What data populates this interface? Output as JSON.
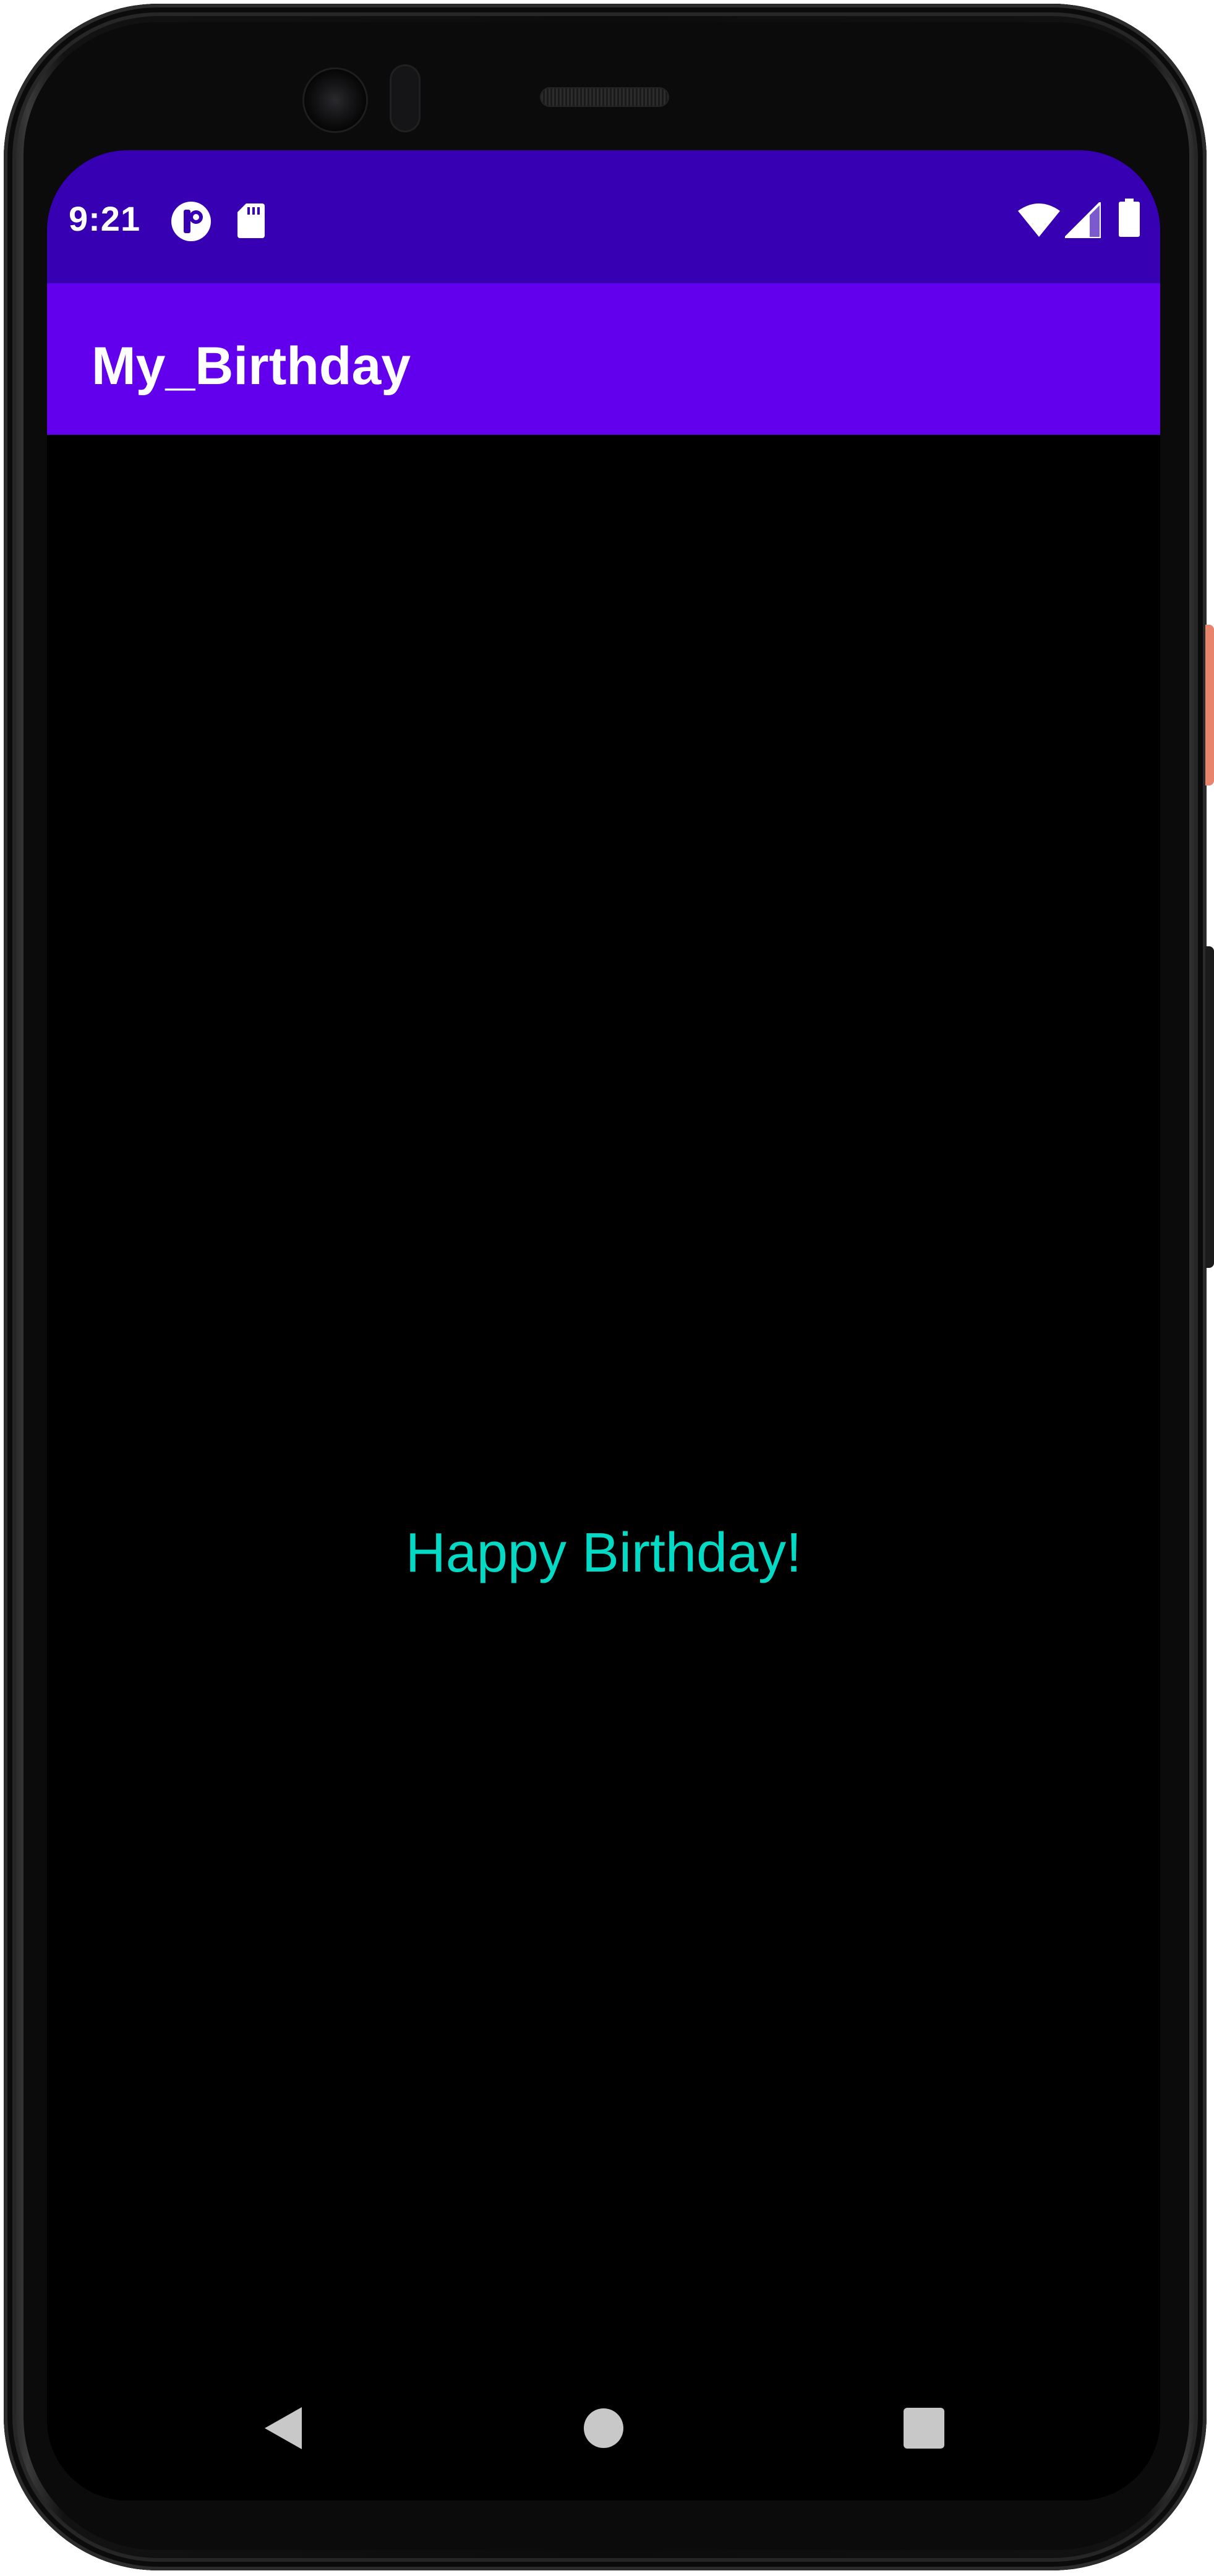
{
  "status_bar": {
    "time": "9:21",
    "left_icons": [
      "app-notification-icon",
      "sd-card-icon"
    ],
    "right_icons": [
      "wifi-icon",
      "cellular-signal-icon",
      "battery-icon"
    ]
  },
  "app_bar": {
    "title": "My_Birthday"
  },
  "content": {
    "greeting": "Happy Birthday!"
  },
  "navigation": {
    "buttons": [
      "back-icon",
      "home-icon",
      "recents-icon"
    ]
  },
  "colors": {
    "status_bar": "#3700b3",
    "app_bar": "#6200ee",
    "background": "#000000",
    "greeting_text": "#03dac5",
    "power_button": "#e8846b"
  }
}
